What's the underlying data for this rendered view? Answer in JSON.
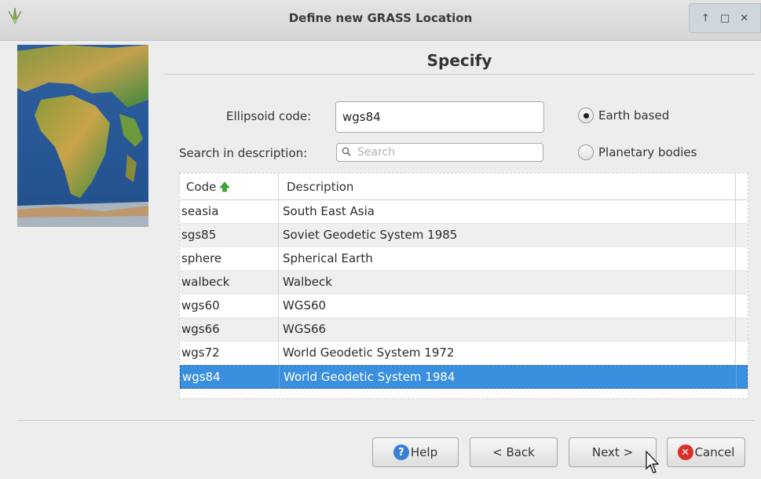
{
  "window": {
    "title": "Define new GRASS Location",
    "controls": [
      "↑",
      "□",
      "✕"
    ]
  },
  "page": {
    "heading": "Specify"
  },
  "form": {
    "ellipsoid_label": "Ellipsoid code:",
    "ellipsoid_value": "wgs84",
    "search_label": "Search in description:",
    "search_placeholder": "Search"
  },
  "radios": {
    "earth": "Earth based",
    "planetary": "Planetary bodies",
    "selected": "earth"
  },
  "table": {
    "headers": {
      "code": "Code",
      "description": "Description"
    },
    "sort": "ascending",
    "rows": [
      {
        "code": "seasia",
        "description": "South East Asia"
      },
      {
        "code": "sgs85",
        "description": "Soviet Geodetic System 1985"
      },
      {
        "code": "sphere",
        "description": "Spherical Earth"
      },
      {
        "code": "walbeck",
        "description": "Walbeck"
      },
      {
        "code": "wgs60",
        "description": "WGS60"
      },
      {
        "code": "wgs66",
        "description": "WGS66"
      },
      {
        "code": "wgs72",
        "description": "World Geodetic System 1972"
      },
      {
        "code": "wgs84",
        "description": "World Geodetic System 1984"
      }
    ],
    "selected_row": 7
  },
  "buttons": {
    "help": "Help",
    "back": "< Back",
    "next": "Next >",
    "cancel": "Cancel"
  },
  "icons": {
    "app": "grass-logo-icon",
    "sort": "sort-up-arrow-icon",
    "help": "help-icon",
    "cancel": "cancel-icon",
    "search": "search-icon"
  },
  "colors": {
    "selection": "#3b8fdf",
    "help_icon": "#3a7fd5",
    "cancel_icon": "#d9302a",
    "sort_arrow": "#3aaa35"
  }
}
